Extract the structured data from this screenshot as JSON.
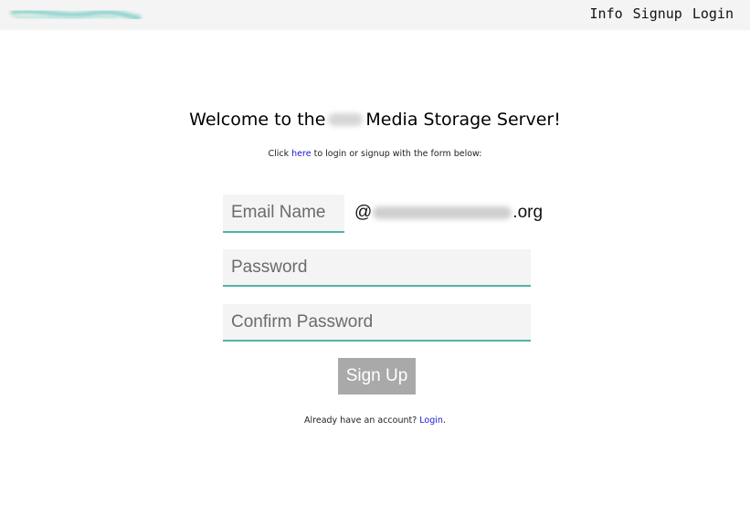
{
  "nav": {
    "items": [
      {
        "label": "Info"
      },
      {
        "label": "Signup"
      },
      {
        "label": "Login"
      }
    ]
  },
  "main": {
    "title_prefix": "Welcome to the",
    "title_suffix": "Media Storage Server!",
    "instructions": {
      "before": "Click ",
      "link": "here",
      "after": " to login or signup with the form below:"
    }
  },
  "form": {
    "email_placeholder": "Email Name",
    "email_value": "",
    "email_at": "@",
    "email_tld": ".org",
    "password_placeholder": "Password",
    "password_value": "",
    "confirm_placeholder": "Confirm Password",
    "confirm_value": "",
    "submit_label": "Sign Up"
  },
  "footer": {
    "prompt": "Already have an account? ",
    "login_link": "Login",
    "trailing": "."
  },
  "colors": {
    "topbar_bg": "#f4f4f4",
    "field_bg": "#f4f4f4",
    "field_underline": "#4fb4a6",
    "link": "#1a1ad6",
    "button_bg": "#a9a9a9"
  },
  "icons": {
    "brand": "redacted-logo"
  }
}
